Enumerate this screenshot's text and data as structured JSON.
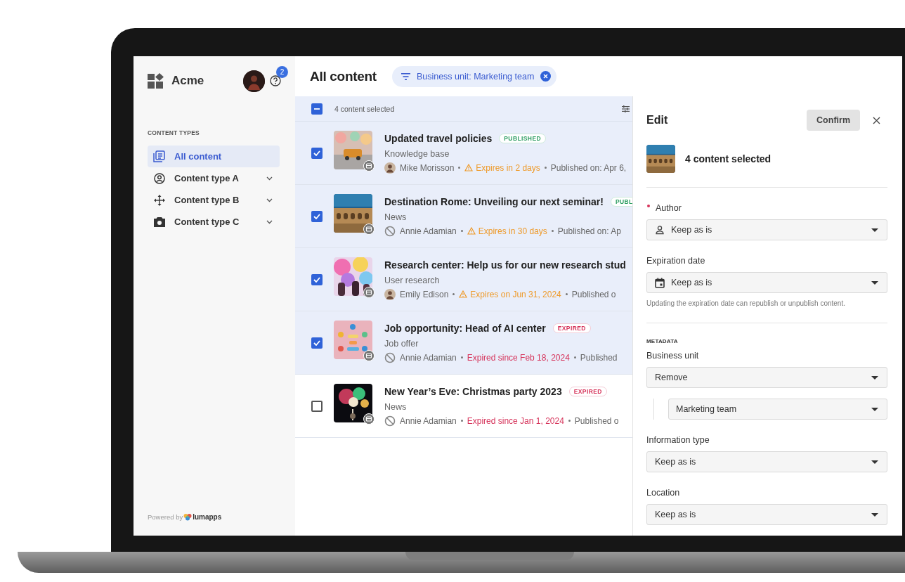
{
  "sidebar": {
    "brand": "Acme",
    "help_badge": "2",
    "section_title": "CONTENT TYPES",
    "items": [
      {
        "label": "All content",
        "selected": true,
        "expandable": false
      },
      {
        "label": "Content type A",
        "selected": false,
        "expandable": true
      },
      {
        "label": "Content type B",
        "selected": false,
        "expandable": true
      },
      {
        "label": "Content type C",
        "selected": false,
        "expandable": true
      }
    ],
    "footer": {
      "text": "Powered by",
      "logo": "lumapps"
    }
  },
  "header": {
    "title": "All content",
    "filter_chip": "Business unit: Marketing team"
  },
  "selection_bar": {
    "indeterminate": true,
    "text": "4 content selected"
  },
  "rows": [
    {
      "checked": true,
      "title": "Updated travel policies",
      "status": {
        "kind": "published",
        "label": "PUBLISHED"
      },
      "category": "Knowledge base",
      "author": {
        "name": "Mike Morisson"
      },
      "expiry": {
        "kind": "warning",
        "text": "Expires in 2 days"
      },
      "published": "Published on: Apr 6,"
    },
    {
      "checked": true,
      "title": "Destination Rome: Unveiling our next seminar!",
      "status": {
        "kind": "published",
        "label": "PUBL"
      },
      "category": "News",
      "author": {
        "kind": "none",
        "name": "Annie Adamian"
      },
      "expiry": {
        "kind": "warning",
        "text": "Expires in 30 days"
      },
      "published": "Published on: Ap"
    },
    {
      "checked": true,
      "title": "Research center: Help us for our new research stud",
      "category": "User research",
      "author": {
        "name": "Emily Edison"
      },
      "expiry": {
        "kind": "warning",
        "text": "Expires on Jun 31, 2024"
      },
      "published": "Published o"
    },
    {
      "checked": true,
      "title": "Job opportunity: Head of AI center",
      "status": {
        "kind": "expired",
        "label": "EXPIRED"
      },
      "category": "Job offer",
      "author": {
        "kind": "none",
        "name": "Annie Adamian"
      },
      "expiry": {
        "kind": "expired",
        "text": "Expired since Feb 18, 2024"
      },
      "published": "Published"
    },
    {
      "checked": false,
      "title": "New Year’s Eve: Christmas party 2023",
      "status": {
        "kind": "expired",
        "label": "EXPIRED"
      },
      "category": "News",
      "author": {
        "kind": "none",
        "name": "Annie Adamian"
      },
      "expiry": {
        "kind": "expired",
        "text": "Expired since Jan 1, 2024"
      },
      "published": "Published o"
    }
  ],
  "edit_panel": {
    "title": "Edit",
    "confirm": "Confirm",
    "selection": "4 content selected",
    "fields": [
      {
        "label": "Author",
        "required": true,
        "kind": "person",
        "value": "Keep as is"
      },
      {
        "label": "Expiration date",
        "required": false,
        "kind": "date",
        "value": "Keep as is",
        "helper": "Updating the expiration date can republish or unpublish content."
      }
    ],
    "metadata_title": "METADATA",
    "metadata_fields": [
      {
        "label": "Business unit",
        "required": false,
        "value": "Remove",
        "children": [
          {
            "value": "Marketing team"
          }
        ]
      },
      {
        "label": "Information type",
        "required": false,
        "value": "Keep as is"
      },
      {
        "label": "Location",
        "required": false,
        "value": "Keep as is"
      }
    ]
  }
}
